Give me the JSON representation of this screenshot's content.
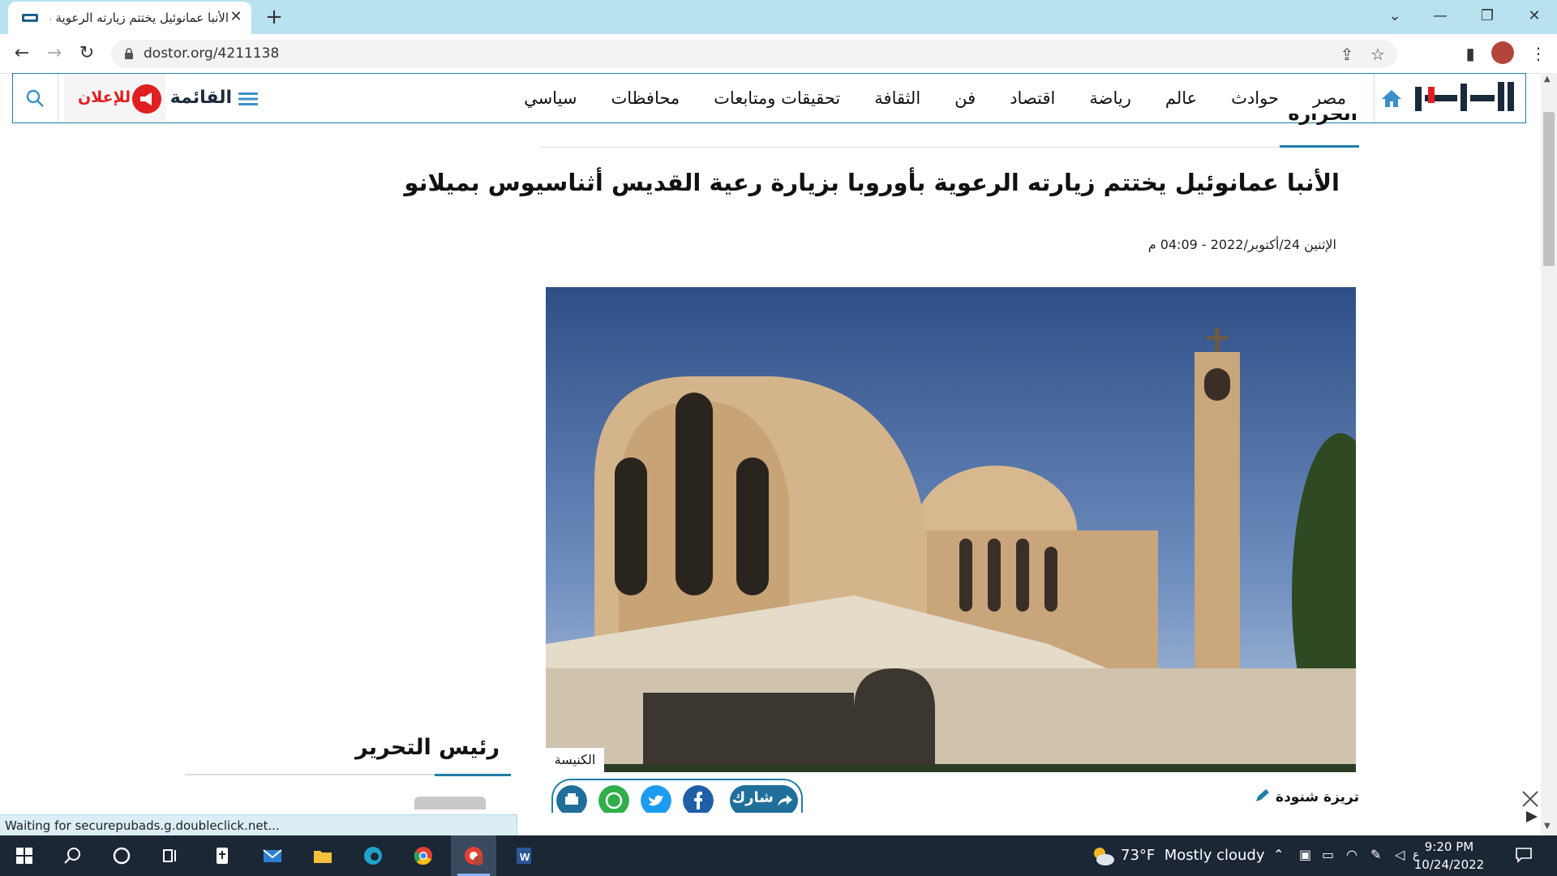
{
  "browser": {
    "tab_title": "الأنبا عمانوئيل يختتم زيارته الرعوية بأوروبا",
    "new_tab_label": "+",
    "url": "dostor.org/4211138"
  },
  "site_nav": {
    "items": [
      "مصر",
      "حوادث",
      "عالم",
      "رياضة",
      "اقتصاد",
      "فن",
      "الثقافة",
      "تحقيقات ومتابعات",
      "محافظات",
      "سياسي"
    ],
    "menu_label": "القائمة",
    "ads_label": "للإعلان"
  },
  "article": {
    "section": "الحرارة",
    "headline": "الأنبا عمانوئيل يختتم زيارته الرعوية بأوروبا بزيارة رعية القديس أثناسيوس بميلانو",
    "date": "الإثنين 24/أكتوبر/2022 - 04:09 م",
    "image_caption": "الكنيسة",
    "share_label": "شارك",
    "author": "تريزة شنودة"
  },
  "sidebar": {
    "editor_title": "رئيس التحرير"
  },
  "status_text": "Waiting for securepubads.g.doubleclick.net...",
  "taskbar": {
    "temperature": "73°F",
    "weather": "Mostly cloudy",
    "time": "9:20 PM",
    "date": "10/24/2022",
    "ime": "ع"
  },
  "colors": {
    "accent": "#1f7fa6",
    "ads_red": "#e02020",
    "tabstrip": "#b8e2f0",
    "taskbar": "#1c2735"
  }
}
